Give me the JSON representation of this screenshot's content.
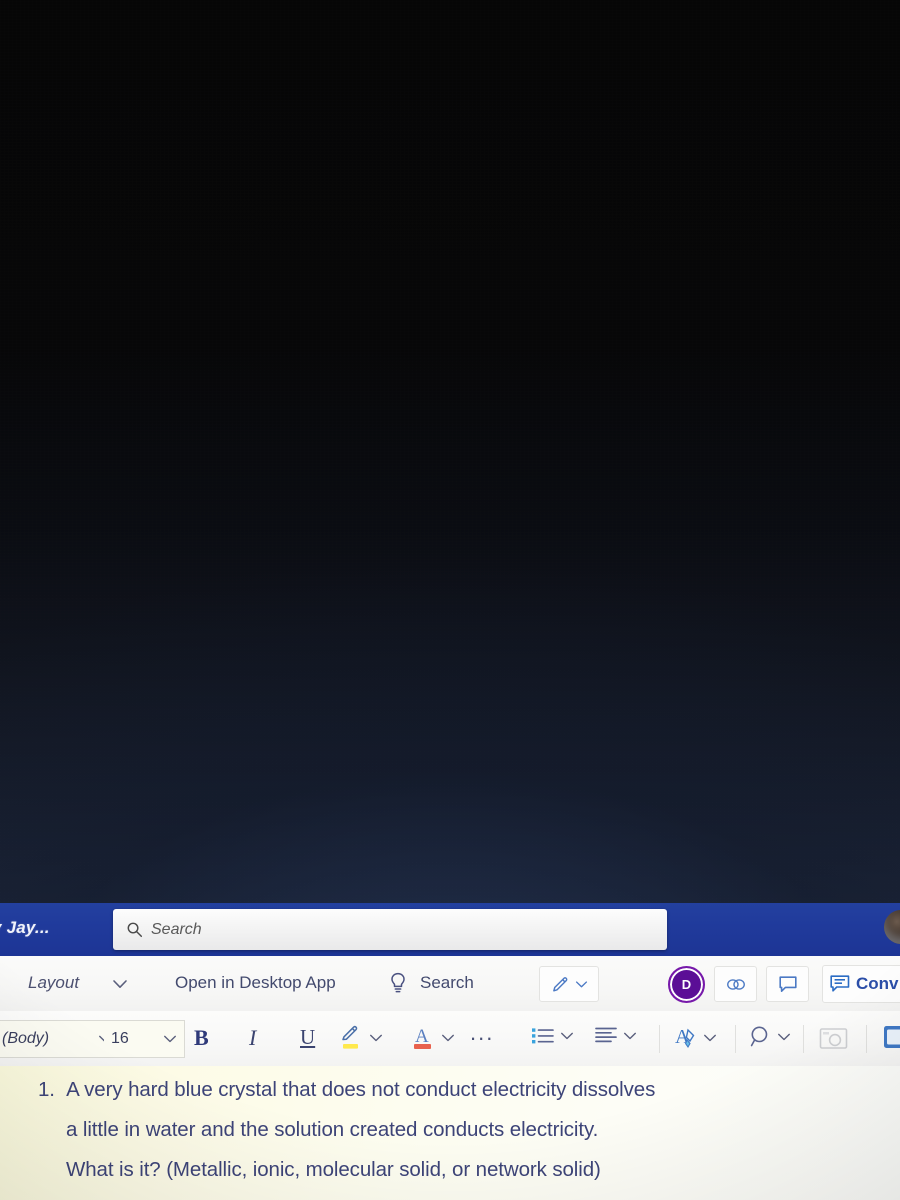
{
  "screen": {
    "dark_area_note": "",
    "app": "word-online"
  },
  "title_bar": {
    "document_title": "y Jay...",
    "search": {
      "icon": "search-icon",
      "placeholder": "Search",
      "value": ""
    },
    "avatar": "user-avatar",
    "background_color": "#203a9b"
  },
  "ribbon": {
    "layout_label": "Layout",
    "layout_chevron": "chevron-down-icon",
    "open_in_desktop_app": "Open in Desktop App",
    "tell_me": {
      "icon": "lightbulb-icon",
      "label": "Search"
    },
    "editing_mode": {
      "icon": "pencil-icon",
      "chevron": "chevron-down-icon"
    },
    "presence": {
      "initial": "D",
      "color": "#5b0e96"
    },
    "share_link_icon": "link-icon",
    "comment_icon": "comment-bubble-icon",
    "conversation": {
      "icon": "conversation-icon",
      "label": "Conv"
    }
  },
  "format_bar": {
    "font_name": "(Body)",
    "font_name_chevron": "chevron-down-icon",
    "font_size": "16",
    "font_size_chevron": "chevron-down-icon",
    "bold": "B",
    "italic": "I",
    "underline": "U",
    "highlight": {
      "icon": "highlighter-icon",
      "color": "#ffe94d",
      "chevron": "chevron-down-icon"
    },
    "font_color": {
      "icon": "font-color-icon",
      "glyph": "A",
      "color": "#e8614d",
      "chevron": "chevron-down-icon"
    },
    "more_formatting": "...",
    "bullets": {
      "icon": "bulleted-list-icon",
      "chevron": "chevron-down-icon"
    },
    "alignment": {
      "icon": "align-left-icon",
      "chevron": "chevron-down-icon"
    },
    "styles": {
      "icon": "format-painter-icon",
      "chevron": "chevron-down-icon"
    },
    "find": {
      "icon": "search-magnifier-icon",
      "chevron": "chevron-down-icon"
    },
    "dictate_icon": "picture-icon",
    "editor_icon": "editor-icon"
  },
  "document": {
    "background_color": "#fdfcee",
    "text_color": "#3d4478",
    "list_marker": "1.",
    "line_1": "A very hard blue crystal that does not conduct electricity dissolves",
    "line_2": "a little in water and the solution created conducts electricity.",
    "line_3": "What is it? (Metallic, ionic, molecular solid, or network solid)"
  }
}
